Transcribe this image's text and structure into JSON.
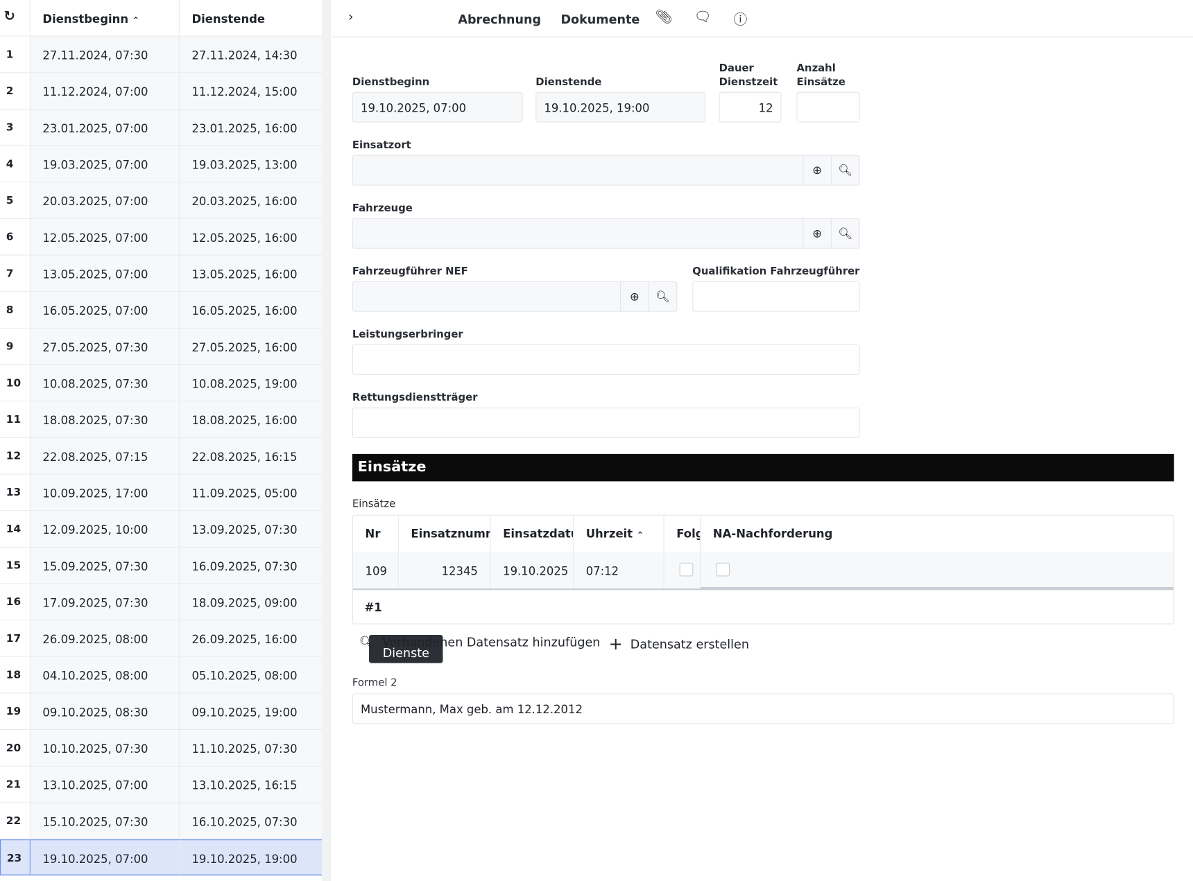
{
  "list": {
    "headers": {
      "start": "Dienstbeginn",
      "end": "Dienstende"
    },
    "rows": [
      [
        "1",
        "27.11.2024, 07:30",
        "27.11.2024, 14:30"
      ],
      [
        "2",
        "11.12.2024, 07:00",
        "11.12.2024, 15:00"
      ],
      [
        "3",
        "23.01.2025, 07:00",
        "23.01.2025, 16:00"
      ],
      [
        "4",
        "19.03.2025, 07:00",
        "19.03.2025, 13:00"
      ],
      [
        "5",
        "20.03.2025, 07:00",
        "20.03.2025, 16:00"
      ],
      [
        "6",
        "12.05.2025, 07:00",
        "12.05.2025, 16:00"
      ],
      [
        "7",
        "13.05.2025, 07:00",
        "13.05.2025, 16:00"
      ],
      [
        "8",
        "16.05.2025, 07:00",
        "16.05.2025, 16:00"
      ],
      [
        "9",
        "27.05.2025, 07:30",
        "27.05.2025, 16:00"
      ],
      [
        "10",
        "10.08.2025, 07:30",
        "10.08.2025, 19:00"
      ],
      [
        "11",
        "18.08.2025, 07:30",
        "18.08.2025, 16:00"
      ],
      [
        "12",
        "22.08.2025, 07:15",
        "22.08.2025, 16:15"
      ],
      [
        "13",
        "10.09.2025, 17:00",
        "11.09.2025, 05:00"
      ],
      [
        "14",
        "12.09.2025, 10:00",
        "13.09.2025, 07:30"
      ],
      [
        "15",
        "15.09.2025, 07:30",
        "16.09.2025, 07:30"
      ],
      [
        "16",
        "17.09.2025, 07:30",
        "18.09.2025, 09:00"
      ],
      [
        "17",
        "26.09.2025, 08:00",
        "26.09.2025, 16:00"
      ],
      [
        "18",
        "04.10.2025, 08:00",
        "05.10.2025, 08:00"
      ],
      [
        "19",
        "09.10.2025, 08:30",
        "09.10.2025, 19:00"
      ],
      [
        "20",
        "10.10.2025, 07:30",
        "11.10.2025, 07:30"
      ],
      [
        "21",
        "13.10.2025, 07:00",
        "13.10.2025, 16:15"
      ],
      [
        "22",
        "15.10.2025, 07:30",
        "16.10.2025, 07:30"
      ],
      [
        "23",
        "19.10.2025, 07:00",
        "19.10.2025, 19:00"
      ]
    ],
    "selected_row": "23"
  },
  "tabs": {
    "dienste": "Dienste",
    "abrechnung": "Abrechnung",
    "dokumente": "Dokumente"
  },
  "form": {
    "dienstbeginn": {
      "label": "Dienstbeginn",
      "value": "19.10.2025, 07:00"
    },
    "dienstende": {
      "label": "Dienstende",
      "value": "19.10.2025, 19:00"
    },
    "dauer": {
      "label1": "Dauer",
      "label2": "Dienstzeit",
      "value": "12"
    },
    "anzahl": {
      "label1": "Anzahl",
      "label2": "Einsätze",
      "value": ""
    },
    "einsatzort": {
      "label": "Einsatzort",
      "value": ""
    },
    "fahrzeuge": {
      "label": "Fahrzeuge",
      "value": ""
    },
    "fuehrer": {
      "label": "Fahrzeugführer NEF",
      "value": ""
    },
    "qualifikation": {
      "label": "Qualifikation Fahrzeugführer",
      "value": ""
    },
    "leistung": {
      "label": "Leistungserbringer",
      "value": ""
    },
    "traeger": {
      "label": "Rettungsdienstträger",
      "value": ""
    },
    "formel": {
      "label": "Formel 2",
      "value": "Mustermann, Max geb. am 12.12.2012"
    }
  },
  "einsaetze": {
    "section_title": "Einsätze",
    "label": "Einsätze",
    "columns": [
      "Nr",
      "Einsatznummer",
      "Einsatzdatum",
      "Uhrzeit",
      "Folgeeinsatz",
      "NA-Nachforderung"
    ],
    "row": {
      "nr": "109",
      "nummer": "12345",
      "datum": "19.10.2025",
      "uhrzeit": "07:12",
      "folge": false,
      "na": false
    },
    "footer": "#1",
    "add_existing": "Vorhandenen Datensatz hinzufügen",
    "create": "Datensatz erstellen"
  },
  "colors": {
    "header_bar": "#0b0b0c",
    "active_tab": "#2c2f36",
    "selected_row": "#dde5fa",
    "selected_border": "#6b8ff0"
  }
}
